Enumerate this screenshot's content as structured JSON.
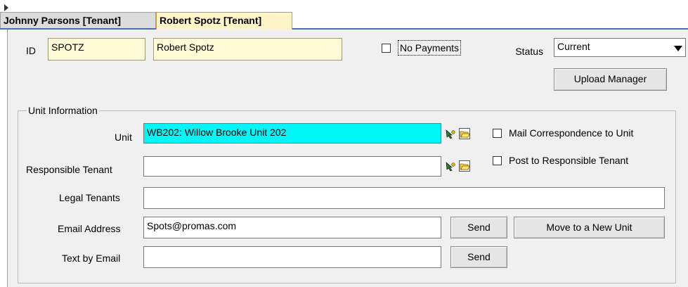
{
  "tabs": [
    {
      "label": "Johnny Parsons  [Tenant]",
      "active": false
    },
    {
      "label": "Robert Spotz  [Tenant]",
      "active": true
    }
  ],
  "header": {
    "id_label": "ID",
    "id_value": "SPOTZ",
    "name_value": "Robert Spotz",
    "no_payments_label": "No Payments",
    "no_payments_checked": false,
    "status_label": "Status",
    "status_value": "Current",
    "upload_manager_label": "Upload Manager"
  },
  "unit_info": {
    "group_title": "Unit Information",
    "unit_label": "Unit",
    "unit_value": "WB202: Willow Brooke Unit 202",
    "responsible_tenant_label": "Responsible Tenant",
    "responsible_tenant_value": "",
    "legal_tenants_label": "Legal Tenants",
    "legal_tenants_value": "",
    "email_label": "Email Address",
    "email_value": "Spots@promas.com",
    "text_by_email_label": "Text by Email",
    "text_by_email_value": "",
    "send_label": "Send",
    "move_unit_label": "Move to a New Unit",
    "mail_correspondence_label": "Mail Correspondence to Unit",
    "mail_correspondence_checked": false,
    "post_responsible_label": "Post to Responsible Tenant",
    "post_responsible_checked": false
  },
  "colors": {
    "unit_field_bg": "#00f7f7",
    "active_tab_bg": "#fff3c8",
    "id_field_bg": "#fffbd6"
  },
  "icons": [
    "lookup-arrow-icon",
    "folder-icon",
    "dropdown-arrow-icon"
  ]
}
